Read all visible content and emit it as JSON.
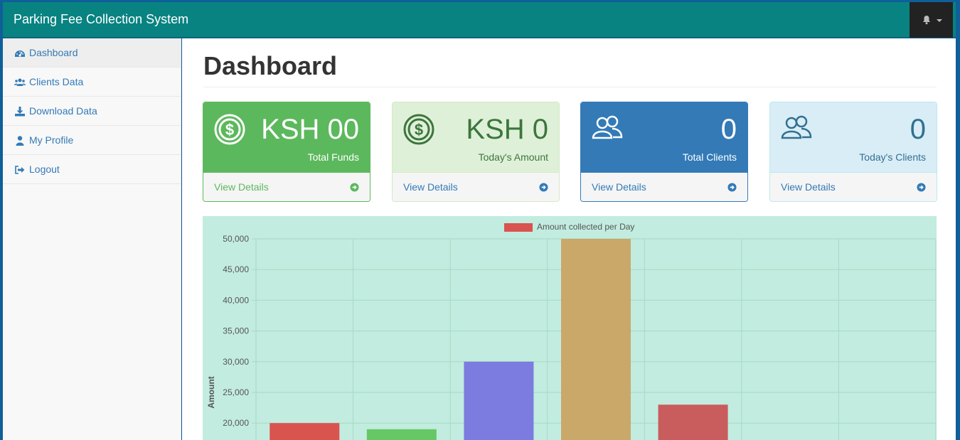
{
  "navbar": {
    "brand": "Parking Fee Collection System",
    "bell_icon": "bell-icon"
  },
  "sidebar": {
    "items": [
      {
        "label": "Dashboard",
        "icon": "dashboard-icon",
        "active": true
      },
      {
        "label": "Clients Data",
        "icon": "users-icon",
        "active": false
      },
      {
        "label": "Download Data",
        "icon": "download-icon",
        "active": false
      },
      {
        "label": "My Profile",
        "icon": "user-icon",
        "active": false
      },
      {
        "label": "Logout",
        "icon": "sign-out-icon",
        "active": false
      }
    ]
  },
  "main": {
    "title": "Dashboard",
    "panels": [
      {
        "value": "KSH 00",
        "label": "Total Funds",
        "link": "View Details",
        "icon": "dollar-coin-icon",
        "color": "#5cb85c"
      },
      {
        "value": "KSH 0",
        "label": "Today's Amount",
        "link": "View Details",
        "icon": "dollar-coin-icon",
        "color": "#dff0d8"
      },
      {
        "value": "0",
        "label": "Total Clients",
        "link": "View Details",
        "icon": "users-outline-icon",
        "color": "#337ab7"
      },
      {
        "value": "0",
        "label": "Today's Clients",
        "link": "View Details",
        "icon": "users-outline-icon",
        "color": "#d9edf7"
      }
    ]
  },
  "chart_data": {
    "type": "bar",
    "legend": "Amount collected per Day",
    "legend_placement": "top",
    "ylabel": "Amount",
    "xlabel": "",
    "ylim_visible": [
      20000,
      50000
    ],
    "y_ticks": [
      "50,000",
      "45,000",
      "40,000",
      "35,000",
      "30,000",
      "25,000",
      "20,000"
    ],
    "y_tick_values": [
      50000,
      45000,
      40000,
      35000,
      30000,
      25000,
      20000
    ],
    "values": [
      20000,
      19000,
      30000,
      50000,
      23000,
      null,
      null
    ],
    "colors": [
      "#d9534f",
      "#66c865",
      "#7b7be0",
      "#c9a86a",
      "#c95c5c"
    ],
    "grid": true,
    "background": "#c2ecdf"
  }
}
